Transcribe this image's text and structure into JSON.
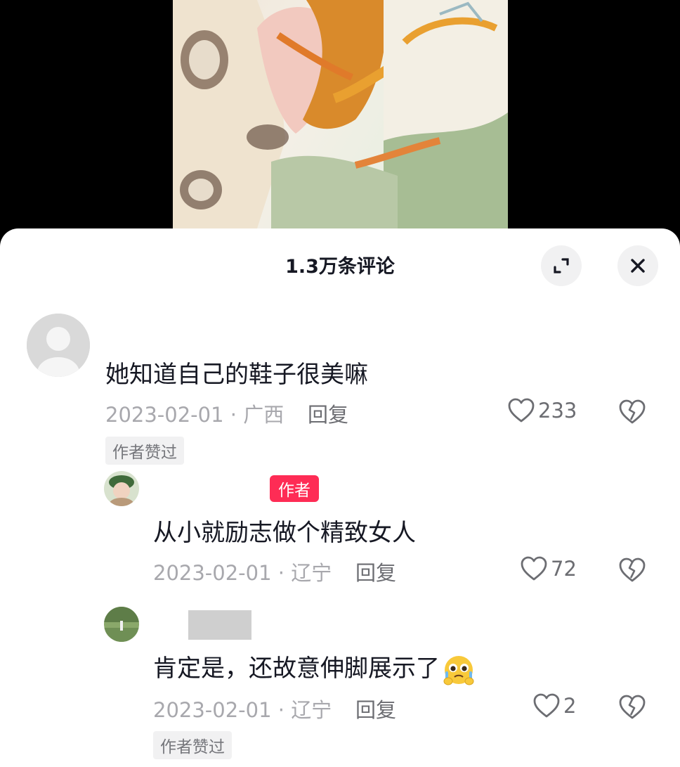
{
  "header": {
    "title": "1.3万条评论"
  },
  "icons": {
    "expand": "expand-icon",
    "close": "close-icon",
    "like": "heart-outline-icon",
    "dislike": "broken-heart-icon",
    "emoji": "pleading-face-emoji"
  },
  "colors": {
    "author_badge": "#fe2c55",
    "tag_bg": "#f1f1f2",
    "meta_text": "#a8a8ad"
  },
  "comments": [
    {
      "text": "她知道自己的鞋子很美嘛",
      "meta": "2023-02-01 · 广西",
      "reply_label": "回复",
      "likes": "233",
      "tag": "作者赞过"
    },
    {
      "badge": "作者",
      "text": "从小就励志做个精致女人",
      "meta": "2023-02-01 · 辽宁",
      "reply_label": "回复",
      "likes": "72"
    },
    {
      "text": "肯定是，还故意伸脚展示了",
      "meta": "2023-02-01 · 辽宁",
      "reply_label": "回复",
      "likes": "2",
      "tag": "作者赞过"
    }
  ]
}
